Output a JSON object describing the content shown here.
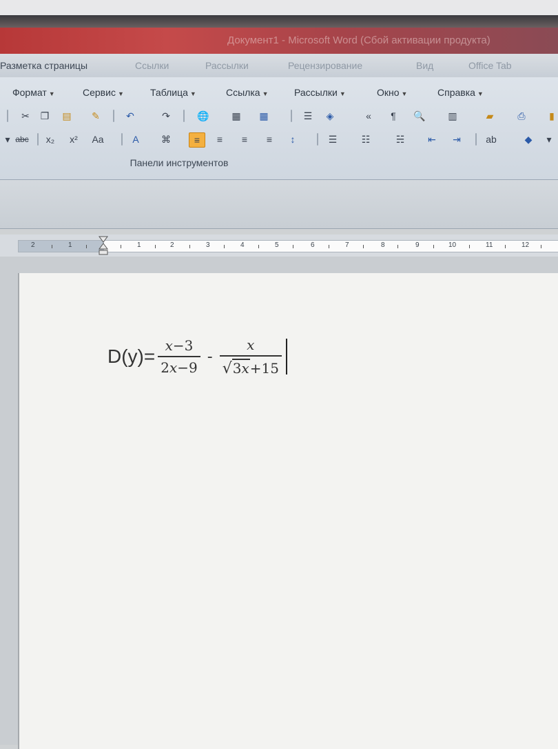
{
  "window": {
    "title": "Документ1 - Microsoft Word (Сбой активации продукта)"
  },
  "ribbon_tabs": [
    {
      "label": "Разметка страницы"
    },
    {
      "label": "Ссылки"
    },
    {
      "label": "Рассылки"
    },
    {
      "label": "Рецензирование"
    },
    {
      "label": "Вид"
    },
    {
      "label": "Office Tab"
    }
  ],
  "menubar": [
    {
      "label": "Формат"
    },
    {
      "label": "Сервис"
    },
    {
      "label": "Таблица"
    },
    {
      "label": "Ссылка"
    },
    {
      "label": "Рассылки"
    },
    {
      "label": "Окно"
    },
    {
      "label": "Справка"
    }
  ],
  "toolbar": {
    "group_label": "Панели инструментов",
    "row2_labels": {
      "strike": "abc",
      "subscript": "x₂",
      "superscript": "x²",
      "change_case": "Aa"
    }
  },
  "ruler": {
    "labels": [
      "2",
      "1",
      "1",
      "2",
      "3",
      "4",
      "5",
      "6",
      "7",
      "8",
      "9",
      "10",
      "11",
      "12"
    ]
  },
  "document": {
    "lhs": "D(y)=",
    "frac1_num_a": "x",
    "frac1_num_b": "−3",
    "frac1_den_a": "2",
    "frac1_den_b": "x",
    "frac1_den_c": "−9",
    "operator": "-",
    "frac2_num": "x",
    "frac2_den_a": "3",
    "frac2_den_b": "x",
    "frac2_den_c": "+15"
  }
}
